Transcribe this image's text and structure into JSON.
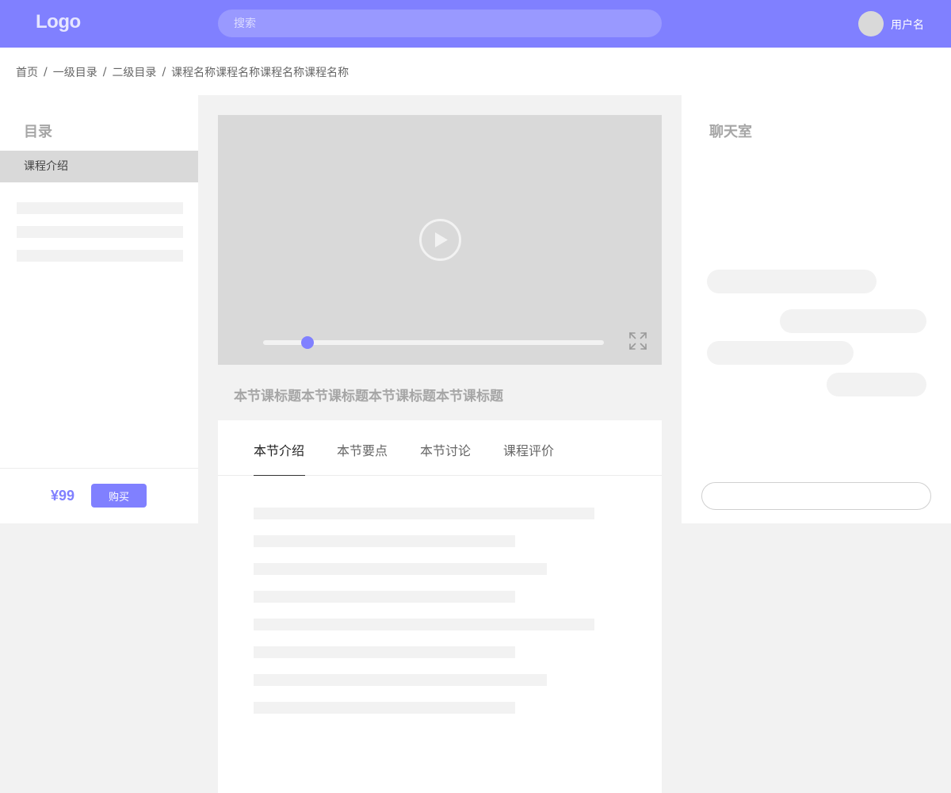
{
  "header": {
    "logo": "Logo",
    "search_placeholder": "搜索",
    "username": "用户名"
  },
  "breadcrumb": [
    "首页",
    "一级目录",
    "二级目录",
    "课程名称课程名称课程名称课程名称"
  ],
  "breadcrumb_separator": "/",
  "sidebar": {
    "title": "目录",
    "active_item": "课程介绍",
    "price": "¥99",
    "buy_label": "购买"
  },
  "video": {
    "progress": 0.13
  },
  "lesson": {
    "title": "本节课标题本节课标题本节课标题本节课标题"
  },
  "tabs": [
    "本节介绍",
    "本节要点",
    "本节讨论",
    "课程评价"
  ],
  "active_tab": 0,
  "chat": {
    "title": "聊天室"
  },
  "colors": {
    "brand": "#8080ff",
    "placeholder_block": "#f2f2f2",
    "video_bg": "#d9d9d9",
    "muted_title": "#a6a6a6"
  }
}
